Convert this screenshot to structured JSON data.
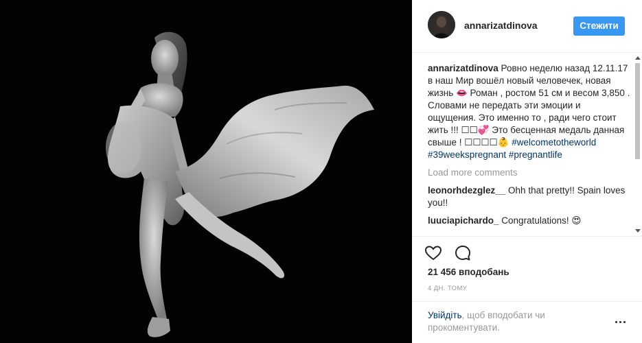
{
  "post": {
    "username": "annarizatdinova",
    "follow_label": "Стежити",
    "caption": {
      "username": "annarizatdinova",
      "text": "Ровно неделю назад 12.11.17 в наш Мир вошёл новый человечек, новая жизнь 👄 Роман , ростом 51 см и весом 3,850 . Словами не передать эти эмоции и ощущения. Это именно то , ради чего стоит жить !!! ☐☐💞 Это бесценная медаль данная свыше ! ☐☐☐☐👶",
      "hashtags": [
        "#welcometotheworld",
        "#39weekspregnant",
        "#pregnantlife"
      ]
    },
    "load_more_label": "Load more comments",
    "comments": [
      {
        "username": "leonorhdezglez__",
        "text": "Ohh that pretty!! Spain loves you!!"
      },
      {
        "username": "luuciapichardo_",
        "text": "Congratulations! 😍"
      }
    ],
    "actions": {
      "like_icon": "heart-outline-icon",
      "comment_icon": "comment-bubble-icon"
    },
    "likes_text": "21 456 вподобань",
    "time_ago": "4 ДН. ТОМУ",
    "footer": {
      "login_link": "Увійдіть",
      "login_rest": ", щоб вподобати чи прокоментувати.",
      "more_icon": "ellipsis-icon"
    },
    "colors": {
      "accent": "#3897f0",
      "link": "#003569",
      "muted": "#999999",
      "text": "#262626",
      "divider": "#efefef"
    }
  }
}
